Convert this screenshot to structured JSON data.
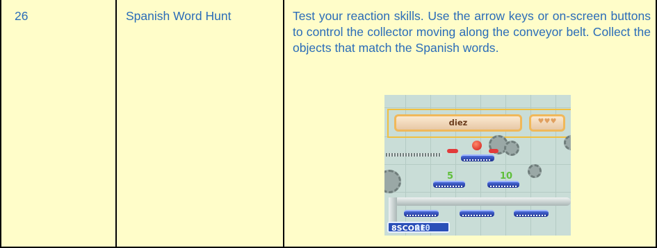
{
  "row": {
    "number": "26",
    "title": "Spanish Word Hunt",
    "description": "Test your reaction skills. Use the arrow keys or on-screen buttons to control the collector moving along the conveyor belt. Collect the objects that match the Spanish words."
  },
  "game": {
    "target_word": "diez",
    "numbers": [
      "5",
      "10"
    ],
    "lives_display": "♥♥♥",
    "score_label": "8SCORE",
    "score_value": "010"
  },
  "colors": {
    "row_background": "#fffdc9",
    "text": "#2a6cb8",
    "border": "#000000"
  }
}
